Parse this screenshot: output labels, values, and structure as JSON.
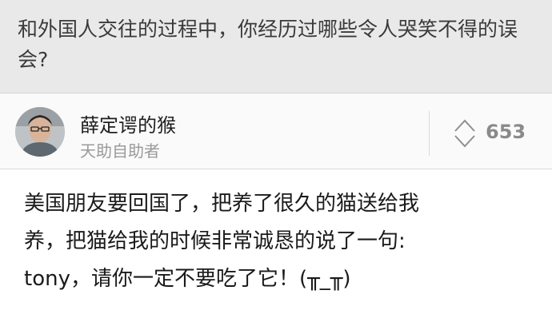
{
  "question": {
    "title": "和外国人交往的过程中，你经历过哪些令人哭笑不得的误会?"
  },
  "author": {
    "name": "薛定谔的猴",
    "bio": "天助自助者",
    "avatar_icon": "avatar-photo"
  },
  "vote": {
    "icon": "up-down-vote-icon",
    "count": "653"
  },
  "answer": {
    "lines": [
      "美国朋友要回国了，把养了很久的猫送给我",
      "养，把猫给我的时候非常诚恳的说了一句:",
      "tony，请你一定不要吃了它！(╥_╥)"
    ]
  },
  "colors": {
    "header_bg": "#e9e9e9",
    "text_primary": "#1a1a1a",
    "text_secondary": "#9a9a9a",
    "vote_color": "#8a8a8a"
  }
}
